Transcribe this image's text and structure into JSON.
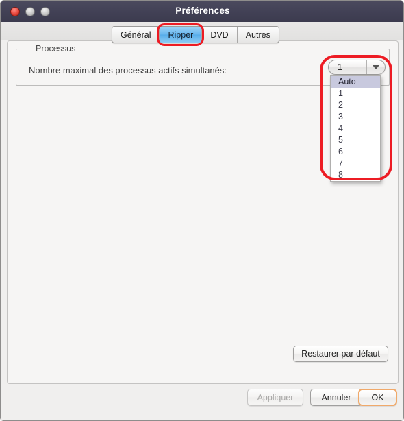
{
  "window": {
    "title": "Préférences",
    "controls": [
      {
        "name": "close",
        "color": "#e8473c"
      },
      {
        "name": "minimize",
        "color": "#c9c9c9"
      },
      {
        "name": "zoom",
        "color": "#c9c9c9"
      }
    ]
  },
  "tabs": {
    "items": [
      {
        "label": "Général",
        "active": false
      },
      {
        "label": "Ripper",
        "active": true
      },
      {
        "label": "DVD",
        "active": false
      },
      {
        "label": "Autres",
        "active": false
      }
    ],
    "active_index": 1,
    "highlight_color": "#ed1c24"
  },
  "group": {
    "title": "Processus",
    "field_label": "Nombre maximal des processus actifs simultanés:"
  },
  "combo": {
    "value": "1",
    "arrow_icon": "chevron-down-icon",
    "expanded": true,
    "selected_option": "Auto",
    "options": [
      "Auto",
      "1",
      "2",
      "3",
      "4",
      "5",
      "6",
      "7",
      "8"
    ],
    "highlight_color": "#c8c9de",
    "annotation_ring_color": "#ed1c24"
  },
  "buttons": {
    "restore_defaults": "Restaurer par défaut",
    "apply": "Appliquer",
    "apply_enabled": false,
    "cancel": "Annuler",
    "ok": "OK",
    "ok_default_ring": "#f0a96a"
  }
}
